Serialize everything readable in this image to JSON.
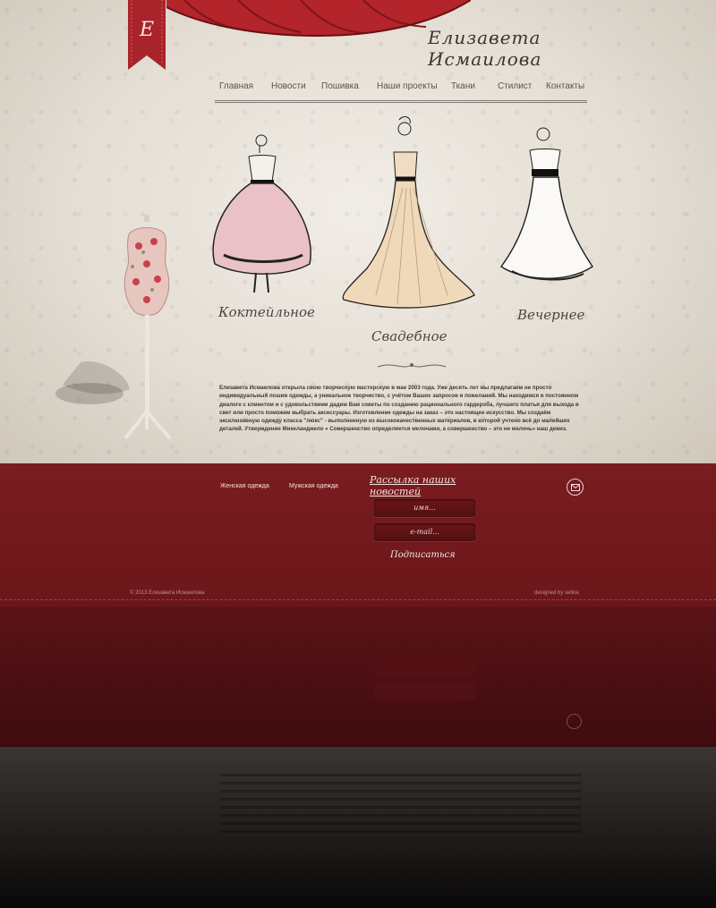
{
  "site": {
    "title": "Елизавета Исмаилова"
  },
  "nav": {
    "items": [
      {
        "label": "Главная"
      },
      {
        "label": "Новости"
      },
      {
        "label": "Пошивка"
      },
      {
        "label": "Наши проекты"
      },
      {
        "label": "Ткани"
      },
      {
        "label": "Стилист"
      },
      {
        "label": "Контакты"
      }
    ]
  },
  "collections": [
    {
      "label": "Коктейльное"
    },
    {
      "label": "Свадебное"
    },
    {
      "label": "Вечернее"
    }
  ],
  "intro": {
    "text": "Елизавета Исмаилова открыла свою творческую мастерскую в мае 2003 года. Уже десять лет мы предлагаем не просто индивидуальный пошив одежды, а уникальное творчество, с учётом Ваших запросов и пожеланий. Мы находимся в постоянном диалоге с клиентом и с удовольствием дадим Вам советы по созданию рационального гардероба, лучшего платья для выхода в свет или просто поможем выбрать аксессуары. Изготовление одежды на заказ – это настоящее искусство. Мы создаём эксклюзивную одежду класса \"люкс\" - выполненную из высококачественных материалов, в которой учтено всё до малейших деталей. Утверждение Микеланджело « Совершенство определяется мелочами, а совершенство – это не мелочь» наш девиз."
  },
  "footer": {
    "women": "Женская одежда",
    "men": "Мужская одежда",
    "newsletter_title": "Рассылка наших новостей",
    "name_placeholder": "имя...",
    "email_placeholder": "e-mail...",
    "subscribe": "Подписаться",
    "copyright": "© 2013 Елизавета Исмаилова",
    "designed": "designed by selina"
  },
  "colors": {
    "accent": "#7a1c20",
    "paper": "#ebe6de"
  }
}
